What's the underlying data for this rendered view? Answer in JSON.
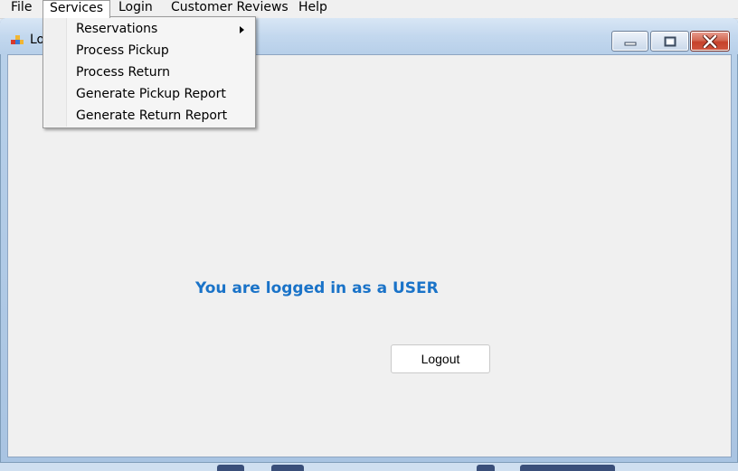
{
  "menubar": {
    "items": [
      "File",
      "Services",
      "Login",
      "Customer Reviews",
      "Help"
    ]
  },
  "services_menu": {
    "items": [
      {
        "label": "Reservations",
        "has_submenu": true
      },
      {
        "label": "Process Pickup",
        "has_submenu": false
      },
      {
        "label": "Process Return",
        "has_submenu": false
      },
      {
        "label": "Generate Pickup Report",
        "has_submenu": false
      },
      {
        "label": "Generate Return Report",
        "has_submenu": false
      }
    ]
  },
  "window": {
    "title": "Lo",
    "icon": "app-window-icon",
    "controls": [
      "minimize-icon",
      "maximize-icon",
      "close-icon"
    ]
  },
  "main": {
    "status_text": "You are logged in as a USER",
    "status_color": "#1a73c8",
    "logout_label": "Logout"
  }
}
